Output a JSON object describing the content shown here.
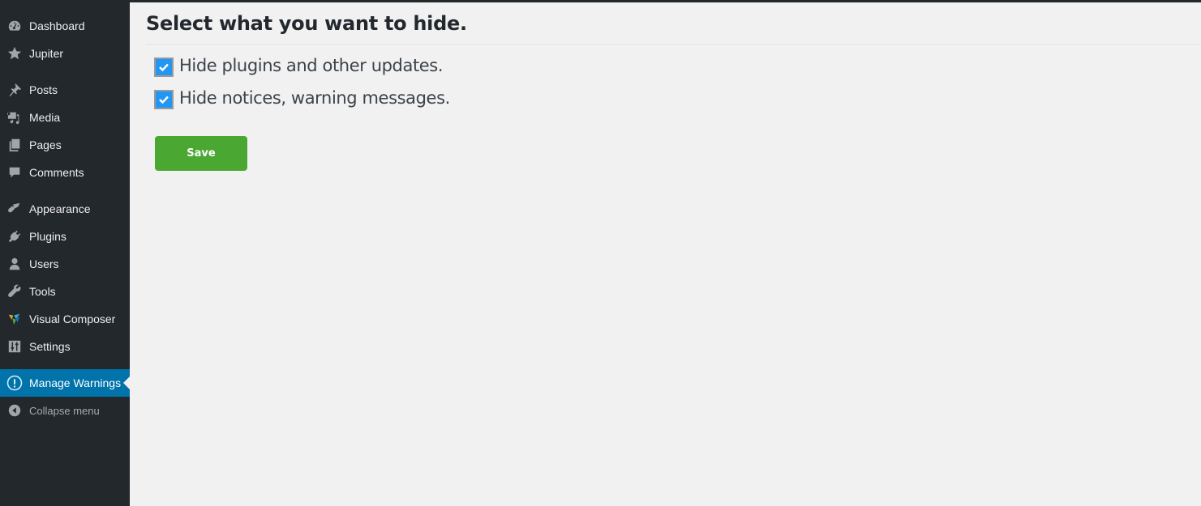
{
  "sidebar": {
    "items": [
      {
        "label": "Dashboard",
        "icon": "dashboard-icon"
      },
      {
        "label": "Jupiter",
        "icon": "star-icon"
      },
      {
        "label": "Posts",
        "icon": "pushpin-icon"
      },
      {
        "label": "Media",
        "icon": "media-icon"
      },
      {
        "label": "Pages",
        "icon": "pages-icon"
      },
      {
        "label": "Comments",
        "icon": "comment-icon"
      },
      {
        "label": "Appearance",
        "icon": "paintbrush-icon"
      },
      {
        "label": "Plugins",
        "icon": "plug-icon"
      },
      {
        "label": "Users",
        "icon": "user-icon"
      },
      {
        "label": "Tools",
        "icon": "wrench-icon"
      },
      {
        "label": "Visual Composer",
        "icon": "visual-composer-icon"
      },
      {
        "label": "Settings",
        "icon": "settings-sliders-icon"
      },
      {
        "label": "Manage Warnings",
        "icon": "warning-circle-icon",
        "active": true
      },
      {
        "label": "Collapse menu",
        "icon": "collapse-arrow-icon"
      }
    ]
  },
  "main": {
    "title": "Select what you want to hide.",
    "options": [
      {
        "label": "Hide plugins and other updates.",
        "checked": true
      },
      {
        "label": "Hide notices, warning messages.",
        "checked": true
      }
    ],
    "save_label": "Save"
  },
  "colors": {
    "sidebar_bg": "#23282d",
    "active_bg": "#0073aa",
    "checkbox": "#2196f3",
    "save_button": "#4aa832",
    "page_bg": "#f1f1f1"
  }
}
